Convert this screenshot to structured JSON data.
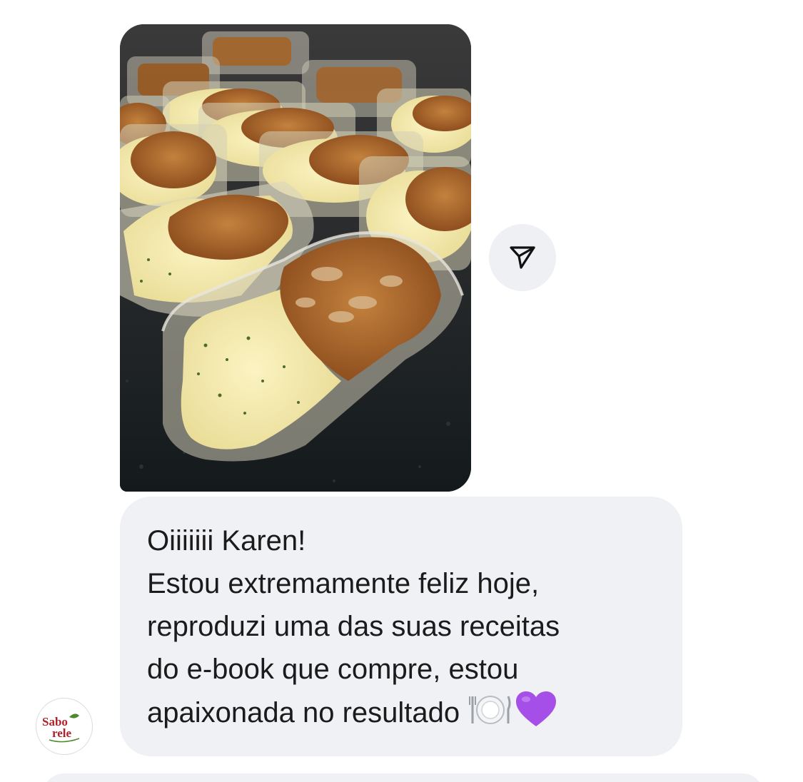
{
  "chat": {
    "photo_message": {
      "image": "food-photo",
      "description_icon": "meal-containers-image"
    },
    "share_button": {
      "icon": "send-icon"
    },
    "text_message": {
      "lines": [
        "Oiiiiiii Karen!",
        "Estou extremamente feliz hoje,",
        "reproduzi uma das suas receitas",
        "do e-book que compre, estou",
        "apaixonada no resultado"
      ],
      "emojis": [
        "🍽️",
        "💜"
      ]
    },
    "sender_avatar": {
      "logo_text_top": "Sabo",
      "logo_text_bottom": "rele",
      "icon": "brand-logo"
    }
  },
  "colors": {
    "bubble_bg": "#eff1f4",
    "text": "#1b1b1b",
    "share_bg": "#eef0f3",
    "heart": "#a64ee8",
    "logo_red": "#b3202a",
    "logo_green": "#4c8a2c"
  }
}
